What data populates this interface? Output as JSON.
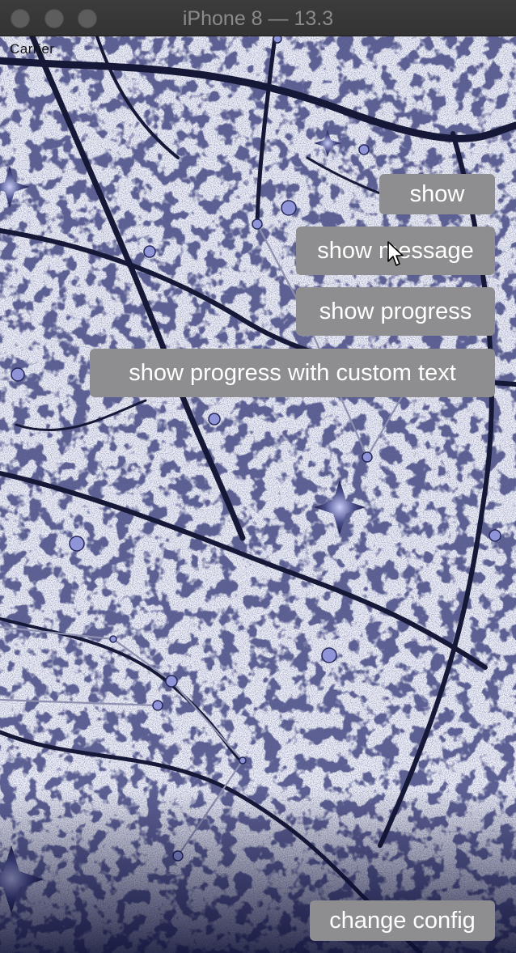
{
  "window": {
    "title": "iPhone 8 — 13.3"
  },
  "status_bar": {
    "carrier": "Carrier"
  },
  "buttons": {
    "show": "show",
    "show_message": "show message",
    "show_progress": "show progress",
    "show_progress_custom": "show progress with custom text",
    "change_config": "change config"
  },
  "icons": {
    "close": "traffic-light-close",
    "minimize": "traffic-light-minimize",
    "zoom": "traffic-light-zoom",
    "cursor": "pointer-arrow-icon"
  },
  "colors": {
    "button_bg": "#8e8e90",
    "button_text": "#ffffff",
    "ink": "#1a1c44"
  }
}
